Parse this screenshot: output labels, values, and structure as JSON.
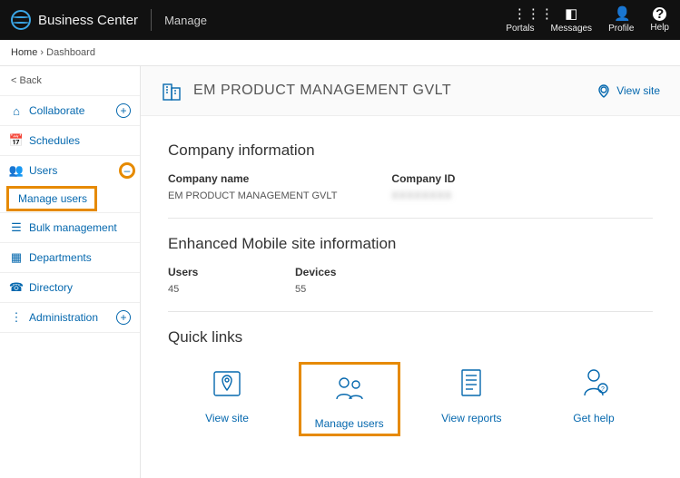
{
  "header": {
    "brand": "Business Center",
    "tab": "Manage",
    "nav": {
      "portals": "Portals",
      "messages": "Messages",
      "profile": "Profile",
      "help": "Help"
    }
  },
  "breadcrumb": {
    "home": "Home",
    "sep": "›",
    "current": "Dashboard"
  },
  "sidebar": {
    "back": "< Back",
    "items": {
      "collaborate": "Collaborate",
      "schedules": "Schedules",
      "users": "Users",
      "manage_users": "Manage users",
      "bulk": "Bulk management",
      "departments": "Departments",
      "directory": "Directory",
      "administration": "Administration"
    },
    "plus": "+",
    "minus": "–"
  },
  "page": {
    "title": "EM PRODUCT MANAGEMENT GVLT",
    "view_site": "View site"
  },
  "company_section": {
    "heading": "Company information",
    "name_label": "Company name",
    "name_value": "EM PRODUCT MANAGEMENT GVLT",
    "id_label": "Company ID",
    "id_value": "XXXXXXXX"
  },
  "site_section": {
    "heading": "Enhanced Mobile site information",
    "users_label": "Users",
    "users_value": "45",
    "devices_label": "Devices",
    "devices_value": "55"
  },
  "quicklinks": {
    "heading": "Quick links",
    "view_site": "View site",
    "manage_users": "Manage users",
    "view_reports": "View reports",
    "get_help": "Get help"
  }
}
